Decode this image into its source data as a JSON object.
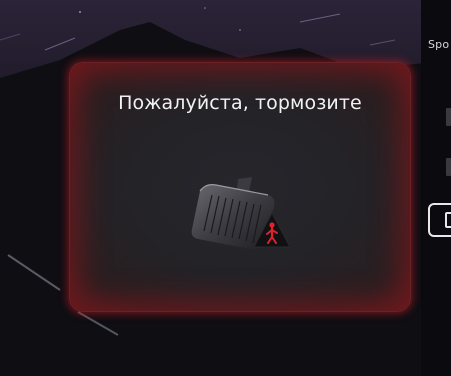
{
  "drive_mode": {
    "label": "Spo"
  },
  "alert": {
    "message": "Пожалуйста, тормозите",
    "icon": "brake-pedal-icon",
    "warning_icon": "pedestrian-warning-icon"
  },
  "colors": {
    "alert_glow": "#be1e24",
    "warning_red": "#e0232b",
    "text": "#f2f2f4",
    "background": "#0c0b0f"
  }
}
